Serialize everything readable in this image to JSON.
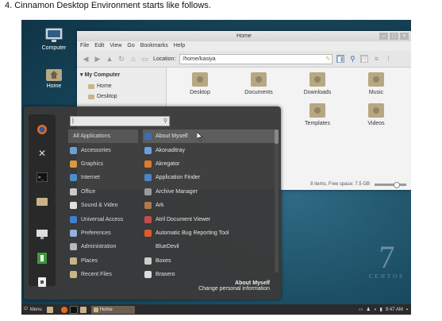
{
  "caption": "4.  Cinnamon Desktop Environment starts like follows.",
  "desktop_icons": [
    {
      "label": "Computer",
      "icon": "monitor-icon"
    },
    {
      "label": "Home",
      "icon": "home-folder-icon"
    }
  ],
  "file_manager": {
    "title": "Home",
    "menu": [
      "File",
      "Edit",
      "View",
      "Go",
      "Bookmarks",
      "Help"
    ],
    "location_label": "Location:",
    "location_value": "/home/kasiya",
    "sidebar_heading": "My Computer",
    "sidebar_items": [
      "Home",
      "Desktop"
    ],
    "folders": [
      "Desktop",
      "Documents",
      "Downloads",
      "Music",
      "Templates",
      "Videos"
    ],
    "status_text": "8 items, Free space: 7.5 GB"
  },
  "menu": {
    "search_placeholder": "",
    "categories": [
      {
        "label": "All Applications",
        "color": "#5d5d5d"
      },
      {
        "label": "Accessories",
        "color": "#6a9fd4"
      },
      {
        "label": "Graphics",
        "color": "#d99a3b"
      },
      {
        "label": "Internet",
        "color": "#4f8ec9"
      },
      {
        "label": "Office",
        "color": "#c9c9c9"
      },
      {
        "label": "Sound & Video",
        "color": "#e0e0e0"
      },
      {
        "label": "Universal Access",
        "color": "#3f7fcf"
      },
      {
        "label": "Preferences",
        "color": "#8fb2d6"
      },
      {
        "label": "Administration",
        "color": "#b8b8b8"
      },
      {
        "label": "Places",
        "color": "#c9b48a"
      },
      {
        "label": "Recent Files",
        "color": "#c9b48a"
      }
    ],
    "apps": [
      {
        "label": "About Myself",
        "color": "#3b6fb5"
      },
      {
        "label": "Akonaditray",
        "color": "#6aa0dc"
      },
      {
        "label": "Akregator",
        "color": "#e07a2a"
      },
      {
        "label": "Application Finder",
        "color": "#4c86c6"
      },
      {
        "label": "Archive Manager",
        "color": "#9a9a9a"
      },
      {
        "label": "Ark",
        "color": "#b07a4a"
      },
      {
        "label": "Atril Document Viewer",
        "color": "#c94a4a"
      },
      {
        "label": "Automatic Bug Reporting Tool",
        "color": "#e05a2a"
      },
      {
        "label": "BlueDevil",
        "color": "#3a3a3a"
      },
      {
        "label": "Boxes",
        "color": "#cccccc"
      },
      {
        "label": "Brasero",
        "color": "#dddddd"
      }
    ],
    "info_title": "About Myself",
    "info_desc": "Change personal information"
  },
  "panel": {
    "menu_label": "Menu",
    "task_label": "Home",
    "clock": "9:47 AM"
  },
  "brand": {
    "numeral": "7",
    "word": "CENTOS"
  }
}
